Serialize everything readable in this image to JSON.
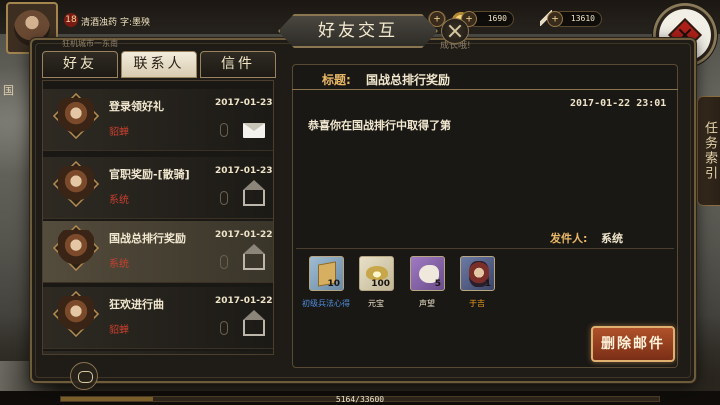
{
  "hud": {
    "level": "18",
    "player_name": "清酒浊药",
    "player_word": "字:墨殃",
    "ingot_amount": "1690",
    "fame_amount": "13610",
    "left_edge_label": "国",
    "quest_tab": "任务索引",
    "exp_text": "5164/33600",
    "exp_fraction": 0.154
  },
  "dialog": {
    "title": "好友交互",
    "ticker_left": "狂机城市一东南",
    "ticker_right": "成长哦!",
    "tabs": [
      {
        "label": "好友",
        "state": "dark"
      },
      {
        "label": "联系人",
        "state": "light"
      },
      {
        "label": "信件",
        "state": "dark"
      }
    ]
  },
  "mails": [
    {
      "subject": "登录领好礼",
      "date": "2017-01-23",
      "sender": "貂蝉",
      "read": false
    },
    {
      "subject": "官职奖励-[散骑]",
      "date": "2017-01-23",
      "sender": "系统",
      "read": true
    },
    {
      "subject": "国战总排行奖励",
      "date": "2017-01-22",
      "sender": "系统",
      "read": true
    },
    {
      "subject": "狂欢进行曲",
      "date": "2017-01-22",
      "sender": "貂蝉",
      "read": true
    }
  ],
  "detail": {
    "subject_label": "标题:",
    "subject": "国战总排行奖励",
    "datetime": "2017-01-22 23:01",
    "body": "恭喜你在国战排行中取得了第",
    "from_label": "发件人:",
    "from": "系统",
    "rewards": [
      {
        "name": "初级兵法心得",
        "qty": "10",
        "name_color": "#4f8fe0"
      },
      {
        "name": "元宝",
        "qty": "100",
        "name_color": "#f0e6cc"
      },
      {
        "name": "声望",
        "qty": "5",
        "name_color": "#f0e6cc"
      },
      {
        "name": "于吉",
        "qty": "1",
        "name_color": "#f0a020"
      }
    ],
    "delete_label": "删除邮件"
  }
}
